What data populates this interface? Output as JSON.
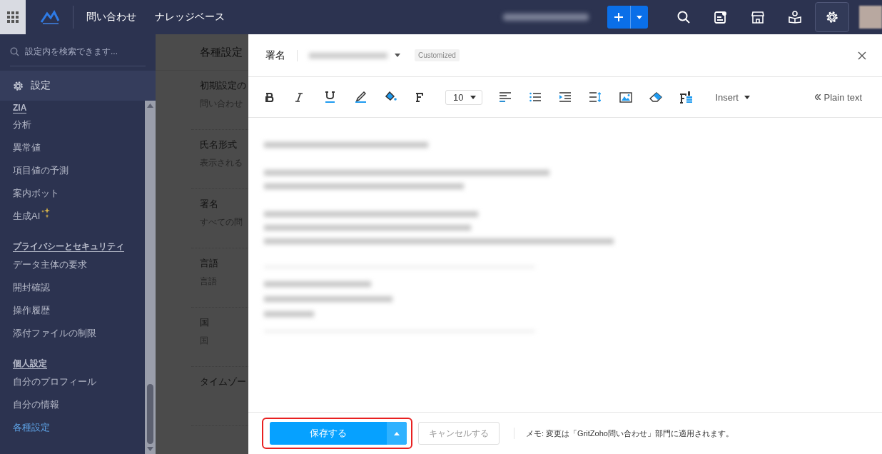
{
  "topbar": {
    "nav_links": [
      {
        "label": "問い合わせ"
      },
      {
        "label": "ナレッジベース"
      }
    ]
  },
  "sidebar": {
    "search": {
      "placeholder": "設定内を検索できます..."
    },
    "header": "設定",
    "sections": [
      {
        "title": "ZIA",
        "items": [
          {
            "label": "分析",
            "kind": "plain",
            "selected": false
          },
          {
            "label": "異常値",
            "kind": "plain",
            "selected": false
          },
          {
            "label": "項目値の予測",
            "kind": "plain",
            "selected": false
          },
          {
            "label": "案内ボット",
            "kind": "plain",
            "selected": false
          },
          {
            "label": "生成AI",
            "kind": "sparkle",
            "selected": false
          }
        ]
      },
      {
        "title": "プライバシーとセキュリティ",
        "items": [
          {
            "label": "データ主体の要求",
            "kind": "plain",
            "selected": false
          },
          {
            "label": "開封確認",
            "kind": "plain",
            "selected": false
          },
          {
            "label": "操作履歴",
            "kind": "plain",
            "selected": false
          },
          {
            "label": "添付ファイルの制限",
            "kind": "plain",
            "selected": false
          }
        ]
      },
      {
        "title": "個人設定",
        "items": [
          {
            "label": "自分のプロフィール",
            "kind": "plain",
            "selected": false
          },
          {
            "label": "自分の情報",
            "kind": "plain",
            "selected": false
          },
          {
            "label": "各種設定",
            "kind": "plain",
            "selected": true
          }
        ]
      }
    ]
  },
  "background_page": {
    "title": "各種設定",
    "rows": [
      {
        "title": "初期設定の",
        "description": "問い合わせ"
      },
      {
        "title": "氏名形式",
        "description": "表示される"
      },
      {
        "title": "署名",
        "description": "すべての問"
      },
      {
        "title": "言語",
        "description": "言語"
      },
      {
        "title": "国",
        "description": "国"
      },
      {
        "title": "タイムゾー"
      }
    ]
  },
  "drawer": {
    "title": "署名",
    "badge": "Customized",
    "toolbar": {
      "font_size": "10",
      "insert": "Insert",
      "plain_text": "Plain text"
    },
    "footer": {
      "save": "保存する",
      "cancel": "キャンセルする",
      "cancel_disabled": true,
      "note": "メモ: 変更は「GritZoho問い合わせ」部門に適用されます。"
    }
  }
}
